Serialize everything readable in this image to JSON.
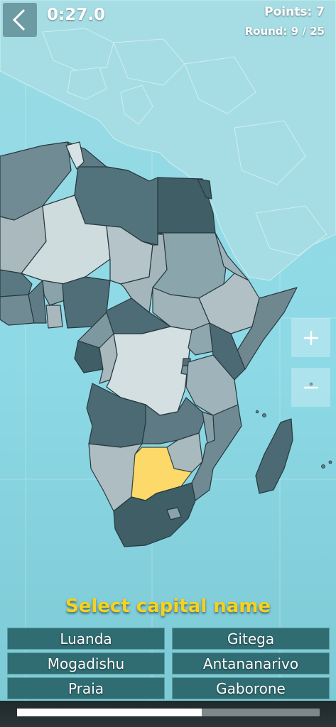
{
  "hud": {
    "timer": "0:27.0",
    "points": "Points: 7",
    "round": "Round: 9 / 25"
  },
  "prompt": "Select capital name",
  "answers": [
    "Luanda",
    "Gitega",
    "Mogadishu",
    "Antananarivo",
    "Praia",
    "Gaborone"
  ],
  "highlighted_country": "Botswana",
  "colors": {
    "ocean": "#8ed9e4",
    "highlight": "#fdd96a",
    "prompt": "#f4d21f",
    "answer_bg": "#2f6d73"
  },
  "progress": {
    "fraction": 0.61
  },
  "icons": {
    "back": "chevron-left-icon",
    "zoom_in": "plus-icon",
    "zoom_out": "minus-icon"
  }
}
